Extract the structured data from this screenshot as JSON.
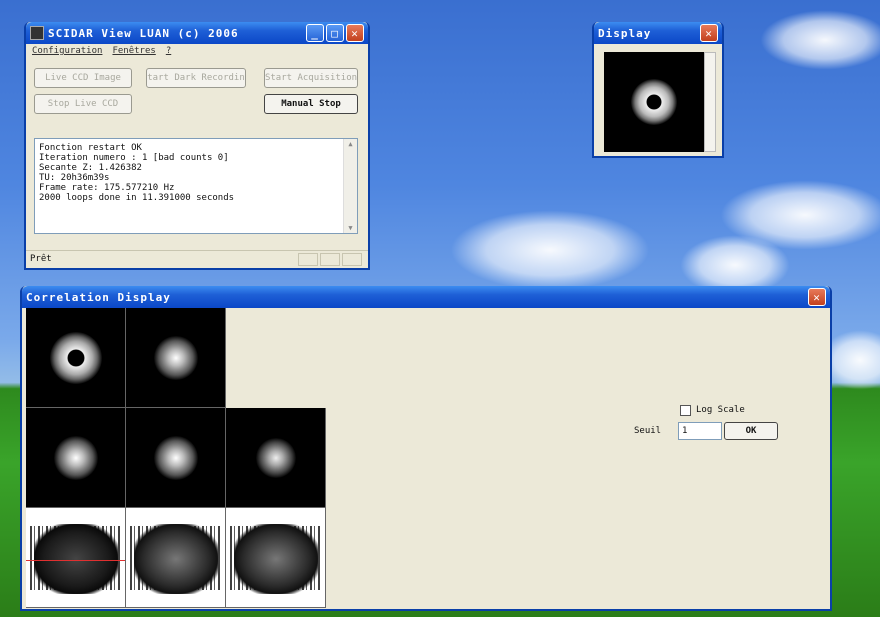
{
  "scidar": {
    "title": "SCIDAR View LUAN (c) 2006",
    "menu": [
      "Configuration",
      "Fenêtres",
      "?"
    ],
    "buttons": {
      "live_ccd": "Live CCD Image",
      "dark_recording": "Start Dark Recording",
      "acquisition": "Start Acquisition",
      "stop_live": "Stop Live CCD",
      "manual_stop": "Manual Stop"
    },
    "log": [
      "Fonction restart OK",
      "Iteration numero : 1 [bad counts 0]",
      "Secante Z: 1.426382",
      "TU: 20h36m39s",
      "Frame rate: 175.577210 Hz",
      "",
      "2000 loops done in 11.391000 seconds"
    ],
    "status": "Prêt"
  },
  "display": {
    "title": "Display"
  },
  "correlation": {
    "title": "Correlation Display",
    "log_scale_label": "Log Scale",
    "log_scale_checked": false,
    "seuil_label": "Seuil",
    "seuil_value": "1",
    "ok_label": "OK"
  },
  "colors": {
    "xp_title": "#0b47c7",
    "window_bg": "#ece9d8",
    "close_red": "#c2401e"
  }
}
